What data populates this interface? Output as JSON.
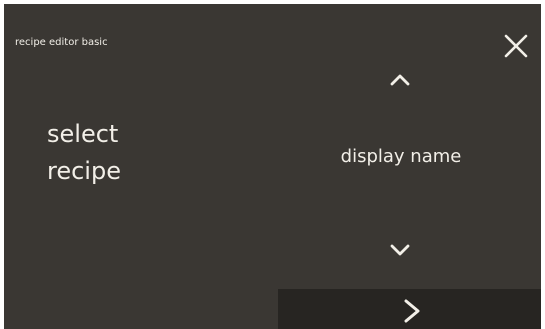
{
  "screen": {
    "title": "recipe editor basic",
    "heading_line1": "select",
    "heading_line2": "recipe",
    "current_value": "display name"
  },
  "icons": {
    "close": "close-icon",
    "up": "chevron-up-icon",
    "down": "chevron-down-icon",
    "next": "chevron-right-icon"
  },
  "colors": {
    "background": "#3a3733",
    "text": "#f2efe8",
    "next_bar": "#272522"
  }
}
